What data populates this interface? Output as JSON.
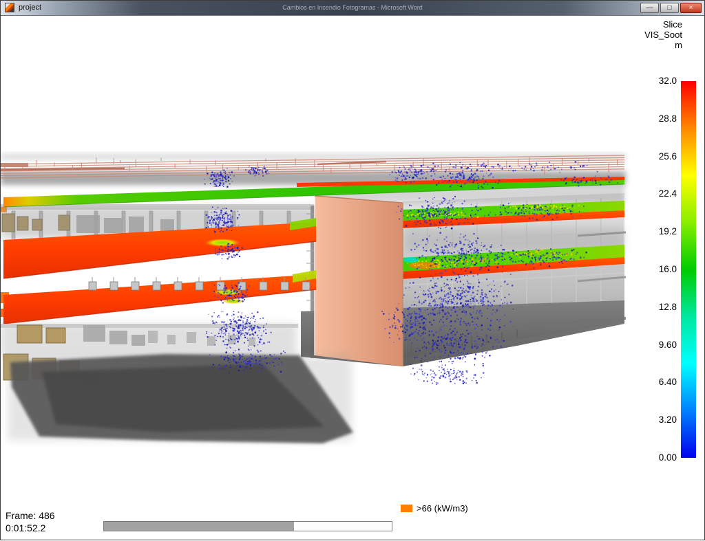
{
  "background_window": {
    "title": "Cambios en Incendio Fotogramas - Microsoft Word"
  },
  "window": {
    "title": "project",
    "controls": {
      "minimize": "—",
      "maximize": "□",
      "close": "×"
    }
  },
  "colorbar": {
    "title_lines": [
      "Slice",
      "VIS_Soot",
      "m"
    ],
    "ticks": [
      "32.0",
      "28.8",
      "25.6",
      "22.4",
      "19.2",
      "16.0",
      "12.8",
      "9.60",
      "6.40",
      "3.20",
      "0.00"
    ],
    "gradient_top_to_bottom": [
      "#ff0000",
      "#ff8800",
      "#ffff00",
      "#88ee00",
      "#00cc00",
      "#00e8a0",
      "#00ffff",
      "#0080ff",
      "#0000ee"
    ]
  },
  "status": {
    "frame": "Frame: 486",
    "time": "0:01:52.2"
  },
  "time_slider": {
    "progress_percent": 66
  },
  "hrr_legend": {
    "label": ">66 (kW/m3)",
    "swatch_color": "#ff8000"
  },
  "scene": {
    "slice_orange": "#ff4400",
    "slice_green": "#33cc00",
    "slice_red_edge": "#ff2800",
    "particle_blue": "#2121cc",
    "wall_salmon": "#edaa8c",
    "pipe_salmon": "#c9887-6",
    "pipe_color": "#c98876",
    "structure_tan": "#b49a62",
    "smoke_gray": "#777777"
  }
}
